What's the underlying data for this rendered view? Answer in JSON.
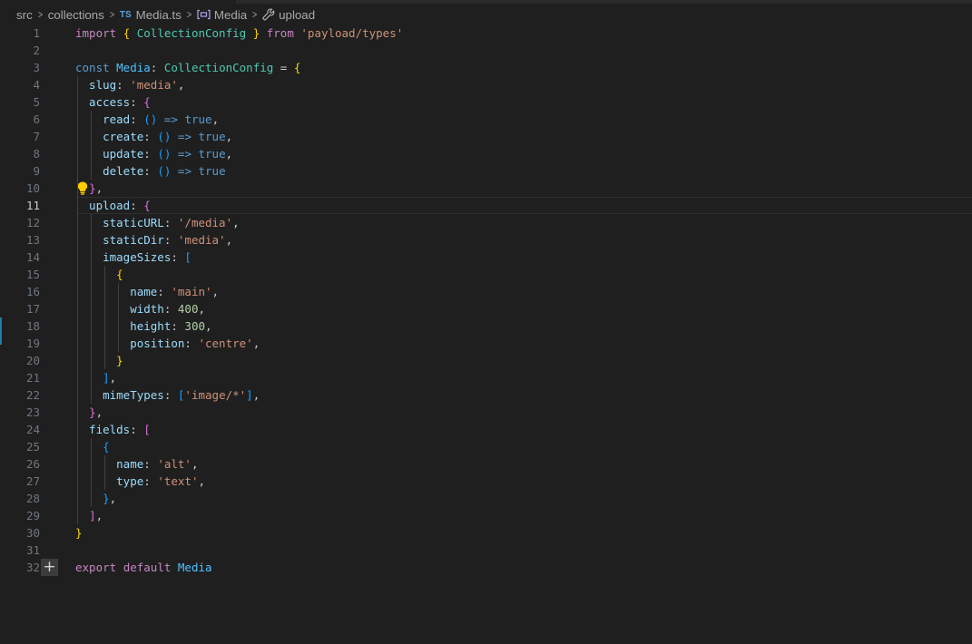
{
  "breadcrumb": {
    "items": [
      "src",
      "collections",
      "Media.ts",
      "Media",
      "upload"
    ],
    "ts_badge": "TS"
  },
  "editor": {
    "current_line": 11,
    "lines": [
      {
        "n": "1",
        "tokens": [
          [
            "import ",
            "kw"
          ],
          [
            "{",
            "b1"
          ],
          [
            " CollectionConfig ",
            "type"
          ],
          [
            "}",
            "b1"
          ],
          [
            " from ",
            "kw"
          ],
          [
            "'payload/types'",
            "str"
          ]
        ]
      },
      {
        "n": "2",
        "tokens": []
      },
      {
        "n": "3",
        "tokens": [
          [
            "const ",
            "dec"
          ],
          [
            "Media",
            "vconst"
          ],
          [
            ": ",
            "p"
          ],
          [
            "CollectionConfig",
            "type"
          ],
          [
            " = ",
            "p"
          ],
          [
            "{",
            "b1"
          ]
        ]
      },
      {
        "n": "4",
        "tokens": [
          [
            "  slug",
            "id"
          ],
          [
            ": ",
            "p"
          ],
          [
            "'media'",
            "str"
          ],
          [
            ",",
            "p"
          ]
        ]
      },
      {
        "n": "5",
        "tokens": [
          [
            "  access",
            "id"
          ],
          [
            ": ",
            "p"
          ],
          [
            "{",
            "b2"
          ]
        ]
      },
      {
        "n": "6",
        "tokens": [
          [
            "    read",
            "id"
          ],
          [
            ": ",
            "p"
          ],
          [
            "()",
            "b3"
          ],
          [
            " => ",
            "dec"
          ],
          [
            "true",
            "dec"
          ],
          [
            ",",
            "p"
          ]
        ]
      },
      {
        "n": "7",
        "tokens": [
          [
            "    create",
            "id"
          ],
          [
            ": ",
            "p"
          ],
          [
            "()",
            "b3"
          ],
          [
            " => ",
            "dec"
          ],
          [
            "true",
            "dec"
          ],
          [
            ",",
            "p"
          ]
        ]
      },
      {
        "n": "8",
        "tokens": [
          [
            "    update",
            "id"
          ],
          [
            ": ",
            "p"
          ],
          [
            "()",
            "b3"
          ],
          [
            " => ",
            "dec"
          ],
          [
            "true",
            "dec"
          ],
          [
            ",",
            "p"
          ]
        ]
      },
      {
        "n": "9",
        "tokens": [
          [
            "    delete",
            "id"
          ],
          [
            ": ",
            "p"
          ],
          [
            "()",
            "b3"
          ],
          [
            " => ",
            "dec"
          ],
          [
            "true",
            "dec"
          ]
        ]
      },
      {
        "n": "10",
        "tokens": [
          [
            "  ",
            "p"
          ],
          [
            "}",
            "b2"
          ],
          [
            ",",
            "p"
          ]
        ]
      },
      {
        "n": "11",
        "tokens": [
          [
            "  upload",
            "id"
          ],
          [
            ": ",
            "p"
          ],
          [
            "{",
            "b2"
          ]
        ]
      },
      {
        "n": "12",
        "tokens": [
          [
            "    staticURL",
            "id"
          ],
          [
            ": ",
            "p"
          ],
          [
            "'/media'",
            "str"
          ],
          [
            ",",
            "p"
          ]
        ]
      },
      {
        "n": "13",
        "tokens": [
          [
            "    staticDir",
            "id"
          ],
          [
            ": ",
            "p"
          ],
          [
            "'media'",
            "str"
          ],
          [
            ",",
            "p"
          ]
        ]
      },
      {
        "n": "14",
        "tokens": [
          [
            "    imageSizes",
            "id"
          ],
          [
            ": ",
            "p"
          ],
          [
            "[",
            "b3"
          ]
        ]
      },
      {
        "n": "15",
        "tokens": [
          [
            "      ",
            "p"
          ],
          [
            "{",
            "b1"
          ]
        ]
      },
      {
        "n": "16",
        "tokens": [
          [
            "        name",
            "id"
          ],
          [
            ": ",
            "p"
          ],
          [
            "'main'",
            "str"
          ],
          [
            ",",
            "p"
          ]
        ]
      },
      {
        "n": "17",
        "tokens": [
          [
            "        width",
            "id"
          ],
          [
            ": ",
            "p"
          ],
          [
            "400",
            "num"
          ],
          [
            ",",
            "p"
          ]
        ]
      },
      {
        "n": "18",
        "tokens": [
          [
            "        height",
            "id"
          ],
          [
            ": ",
            "p"
          ],
          [
            "300",
            "num"
          ],
          [
            ",",
            "p"
          ]
        ]
      },
      {
        "n": "19",
        "tokens": [
          [
            "        position",
            "id"
          ],
          [
            ": ",
            "p"
          ],
          [
            "'centre'",
            "str"
          ],
          [
            ",",
            "p"
          ]
        ]
      },
      {
        "n": "20",
        "tokens": [
          [
            "      ",
            "p"
          ],
          [
            "}",
            "b1"
          ]
        ]
      },
      {
        "n": "21",
        "tokens": [
          [
            "    ",
            "p"
          ],
          [
            "]",
            "b3"
          ],
          [
            ",",
            "p"
          ]
        ]
      },
      {
        "n": "22",
        "tokens": [
          [
            "    mimeTypes",
            "id"
          ],
          [
            ": ",
            "p"
          ],
          [
            "[",
            "b3"
          ],
          [
            "'image/*'",
            "str"
          ],
          [
            "]",
            "b3"
          ],
          [
            ",",
            "p"
          ]
        ]
      },
      {
        "n": "23",
        "tokens": [
          [
            "  ",
            "p"
          ],
          [
            "}",
            "b2"
          ],
          [
            ",",
            "p"
          ]
        ]
      },
      {
        "n": "24",
        "tokens": [
          [
            "  fields",
            "id"
          ],
          [
            ": ",
            "p"
          ],
          [
            "[",
            "b2"
          ]
        ]
      },
      {
        "n": "25",
        "tokens": [
          [
            "    ",
            "p"
          ],
          [
            "{",
            "b3"
          ]
        ]
      },
      {
        "n": "26",
        "tokens": [
          [
            "      name",
            "id"
          ],
          [
            ": ",
            "p"
          ],
          [
            "'alt'",
            "str"
          ],
          [
            ",",
            "p"
          ]
        ]
      },
      {
        "n": "27",
        "tokens": [
          [
            "      type",
            "id"
          ],
          [
            ": ",
            "p"
          ],
          [
            "'text'",
            "str"
          ],
          [
            ",",
            "p"
          ]
        ]
      },
      {
        "n": "28",
        "tokens": [
          [
            "    ",
            "p"
          ],
          [
            "}",
            "b3"
          ],
          [
            ",",
            "p"
          ]
        ]
      },
      {
        "n": "29",
        "tokens": [
          [
            "  ",
            "p"
          ],
          [
            "]",
            "b2"
          ],
          [
            ",",
            "p"
          ]
        ]
      },
      {
        "n": "30",
        "tokens": [
          [
            "}",
            "b1"
          ]
        ]
      },
      {
        "n": "31",
        "tokens": []
      },
      {
        "n": "32",
        "tokens": [
          [
            "export ",
            "kw"
          ],
          [
            "default ",
            "kw"
          ],
          [
            "Media",
            "vconst"
          ]
        ]
      }
    ],
    "guides": [
      {
        "from": 4,
        "to": 29,
        "level": 1
      },
      {
        "from": 6,
        "to": 9,
        "level": 2
      },
      {
        "from": 12,
        "to": 22,
        "level": 2
      },
      {
        "from": 15,
        "to": 20,
        "level": 3
      },
      {
        "from": 16,
        "to": 19,
        "level": 4
      },
      {
        "from": 25,
        "to": 28,
        "level": 2
      },
      {
        "from": 26,
        "to": 27,
        "level": 3
      }
    ],
    "lightbulb_line": 10,
    "add_line": 32
  }
}
